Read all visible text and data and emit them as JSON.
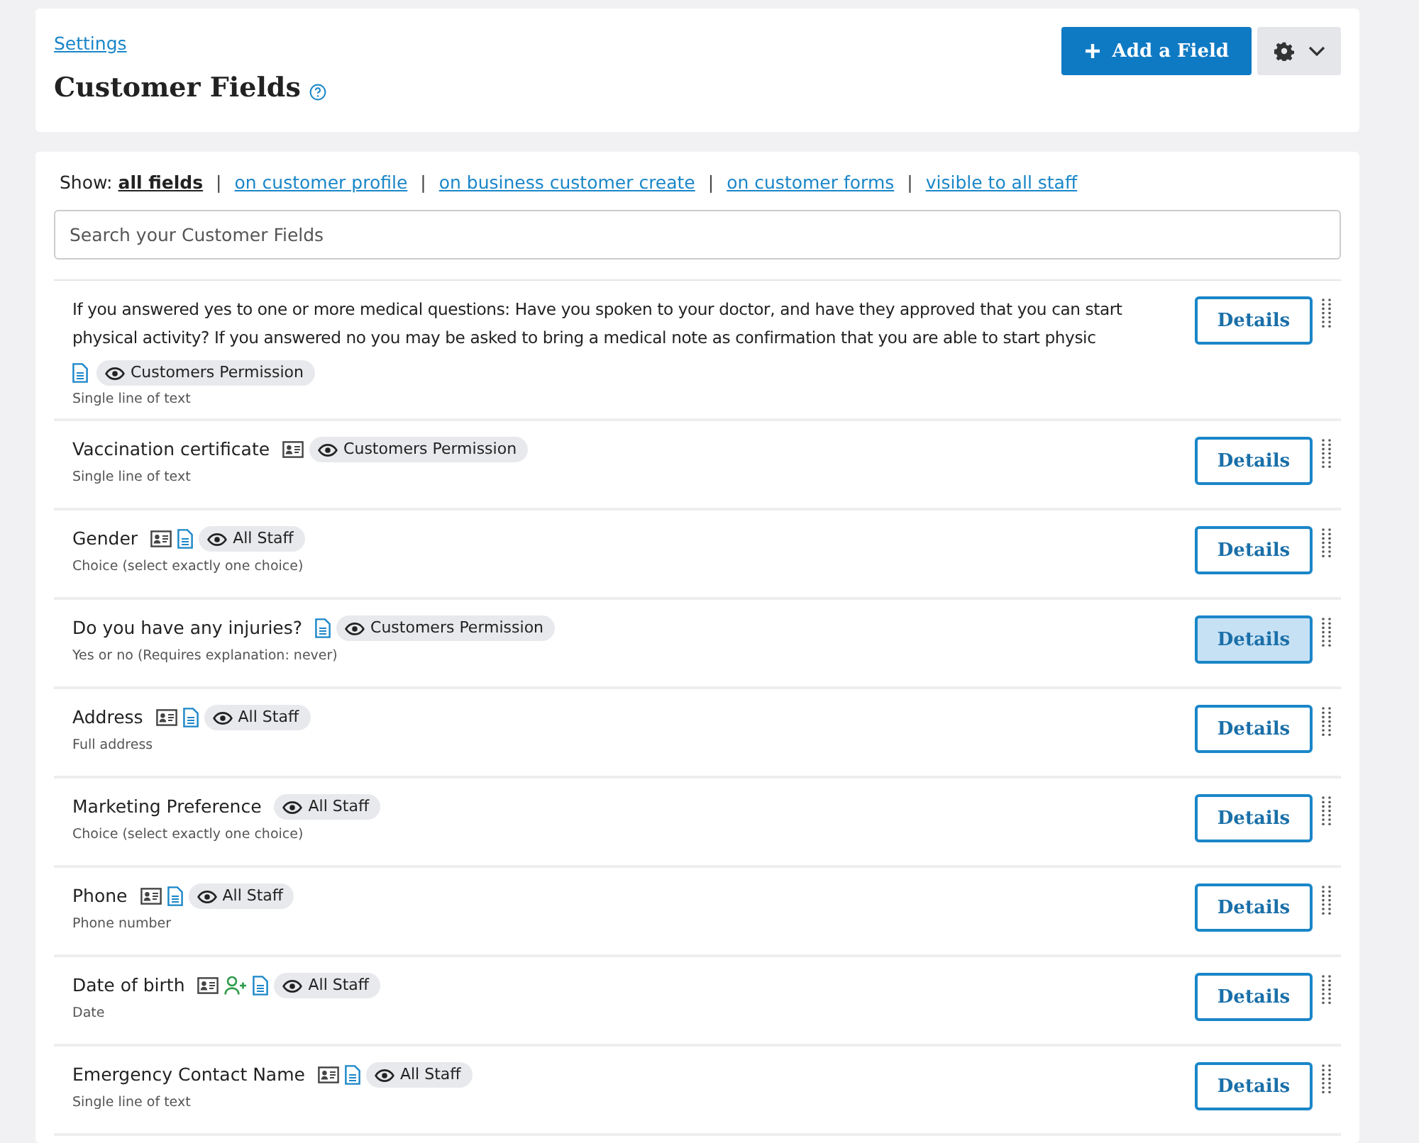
{
  "breadcrumb": "Settings",
  "title": "Customer Fields",
  "add_button": "Add a Field",
  "filter": {
    "label": "Show:",
    "options": [
      {
        "label": "all fields",
        "selected": true
      },
      {
        "label": "on customer profile",
        "selected": false
      },
      {
        "label": "on business customer create",
        "selected": false
      },
      {
        "label": "on customer forms",
        "selected": false
      },
      {
        "label": "visible to all staff",
        "selected": false
      }
    ],
    "separator": "|"
  },
  "search": {
    "placeholder": "Search your Customer Fields"
  },
  "fields": [
    {
      "name": "If you answered yes to one or more medical questions: Have you spoken to your doctor, and have they approved that you can start physical activity? If you answered no you may be asked to bring a medical note as confirmation that you are able to start physic",
      "icons": [
        {
          "kind": "form"
        }
      ],
      "badge": "Customers Permission",
      "type": "Single line of text",
      "button": "Details",
      "hovered": false
    },
    {
      "name": "Vaccination certificate",
      "icons": [
        {
          "kind": "profile"
        }
      ],
      "badge": "Customers Permission",
      "type": "Single line of text",
      "button": "Details",
      "hovered": false
    },
    {
      "name": "Gender",
      "icons": [
        {
          "kind": "profile"
        },
        {
          "kind": "form"
        }
      ],
      "badge": "All Staff",
      "type": "Choice (select exactly one choice)",
      "button": "Details",
      "hovered": false
    },
    {
      "name": "Do you have any injuries?",
      "icons": [
        {
          "kind": "form"
        }
      ],
      "badge": "Customers Permission",
      "type": "Yes or no (Requires explanation: never)",
      "button": "Details",
      "hovered": true
    },
    {
      "name": "Address",
      "icons": [
        {
          "kind": "profile"
        },
        {
          "kind": "form"
        }
      ],
      "badge": "All Staff",
      "type": "Full address",
      "button": "Details",
      "hovered": false
    },
    {
      "name": "Marketing Preference",
      "badge": "All Staff",
      "type": "Choice (select exactly one choice)",
      "button": "Details",
      "hovered": false
    },
    {
      "name": "Phone",
      "icons": [
        {
          "kind": "profile"
        },
        {
          "kind": "form"
        }
      ],
      "badge": "All Staff",
      "type": "Phone number",
      "button": "Details",
      "hovered": false
    },
    {
      "name": "Date of birth",
      "icons": [
        {
          "kind": "profile"
        },
        {
          "kind": "business"
        },
        {
          "kind": "form"
        }
      ],
      "badge": "All Staff",
      "type": "Date",
      "button": "Details",
      "hovered": false
    },
    {
      "name": "Emergency Contact Name",
      "icons": [
        {
          "kind": "profile"
        },
        {
          "kind": "form"
        }
      ],
      "badge": "All Staff",
      "type": "Single line of text",
      "button": "Details",
      "hovered": false
    }
  ]
}
